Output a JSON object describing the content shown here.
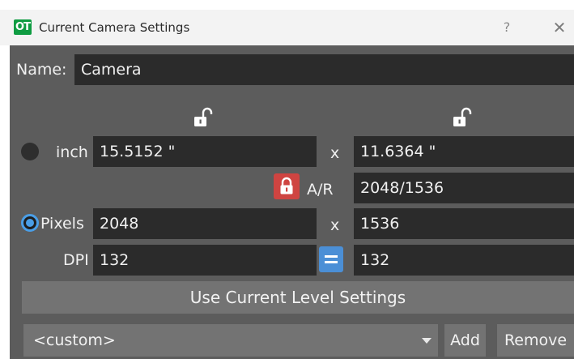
{
  "window": {
    "title": "Current Camera Settings",
    "app_icon_text": "OT",
    "help_label": "?",
    "close_label": "✕"
  },
  "name_row": {
    "label": "Name:",
    "value": "Camera"
  },
  "inch_row": {
    "unit_label": "inch",
    "width": "15.5152 \"",
    "separator": "x",
    "height": "11.6364 \""
  },
  "ar_row": {
    "label": "A/R",
    "value": "2048/1536"
  },
  "pixels_row": {
    "unit_label": "Pixels",
    "width": "2048",
    "separator": "x",
    "height": "1536"
  },
  "dpi_row": {
    "label": "DPI",
    "x_value": "132",
    "y_value": "132"
  },
  "buttons": {
    "use_current": "Use Current Level Settings",
    "add": "Add",
    "remove": "Remove"
  },
  "preset": {
    "selected": "<custom>"
  },
  "colors": {
    "panel": "#5c5c5c",
    "field": "#2b2b2b",
    "lock_red": "#cf4441",
    "accent_blue": "#4b8fd6",
    "app_green": "#0f9c42"
  },
  "icons": {
    "lock_open": "lock-open-icon",
    "lock_closed": "lock-closed-icon",
    "equal": "equal-icon",
    "dropdown": "chevron-down-icon"
  }
}
